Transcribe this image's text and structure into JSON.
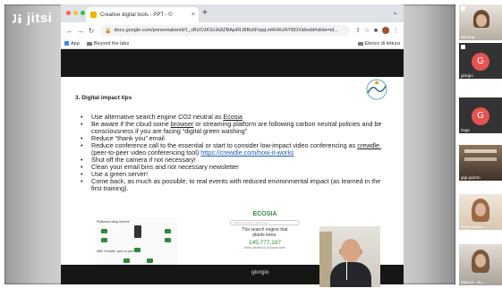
{
  "app": {
    "logo_text": "jitsi"
  },
  "browser": {
    "tab_title": "Creative digital tools - PPT - ©",
    "tab_close": "×",
    "new_tab": "+",
    "address": "docs.google.com/presentation/d/1_vBUOJK3o3k8ZBAjsRL8IBs6FiqqLmRHKsNYBDXld/edit#slide=id...",
    "bookmarks": {
      "apps": "App",
      "item": "Beyond the labs",
      "reading_list": "Elenco di lettura"
    }
  },
  "slide": {
    "number": "3.",
    "title": "Digital impact tips",
    "bullets": [
      {
        "before": "Use alternative search engine CO2 neutral as ",
        "link": "Ecosia",
        "after": ""
      },
      {
        "before": "Be aware if the cloud some ",
        "link": "browser",
        "after": " or streaming platform are following carbon neutral policies and be consciousness if you are facing “digital green washing”"
      },
      {
        "before": "Reduce “thank you” email",
        "link": "",
        "after": ""
      },
      {
        "before": "Reduce conference call to the essential or start to consider low-impact video conferencing as ",
        "link": "crewdle.",
        "after": " (peer-to-peer video conferencing tool) ",
        "url": "https://crewdle.com/how-it-works"
      },
      {
        "before": "Shut off the camera if not necessary!",
        "link": "",
        "after": ""
      },
      {
        "before": "Clean your email bins and not necessary newsletter",
        "link": "",
        "after": ""
      },
      {
        "before": "Use a green server!",
        "link": "",
        "after": ""
      },
      {
        "before": "Come back, as much as possible, to real events with reduced environmental impact (as learned in the first training).",
        "link": "",
        "after": ""
      }
    ],
    "left_thumb": {
      "label_top": "Platforms using servers",
      "label_bottom": "With Crewdle, peer-to-peer"
    },
    "right_thumb": {
      "brand": "ECOSIA",
      "search_placeholder": "Search the web to plant trees...",
      "tagline_1": "The search engine that",
      "tagline_2": "plants trees.",
      "count": "145,777,187",
      "count_caption": "trees planted by Ecosia users"
    }
  },
  "presenter_name": "giorgio",
  "participants": [
    {
      "name": "Merima",
      "kind": "camera"
    },
    {
      "name": "giorgio",
      "kind": "avatar",
      "initial": "G",
      "active": true
    },
    {
      "name": "Gaja",
      "kind": "avatar",
      "initial": "G"
    },
    {
      "name": "gigi guizzo",
      "kind": "camera"
    },
    {
      "name": "Hana (Uma...",
      "kind": "camera"
    },
    {
      "name": "Manca - Hu...",
      "kind": "camera"
    }
  ],
  "colors": {
    "accent": "#4b7bd6",
    "avatar": "#e55353",
    "link": "#1a5fb4",
    "ecosia_green": "#2f8a3e"
  }
}
